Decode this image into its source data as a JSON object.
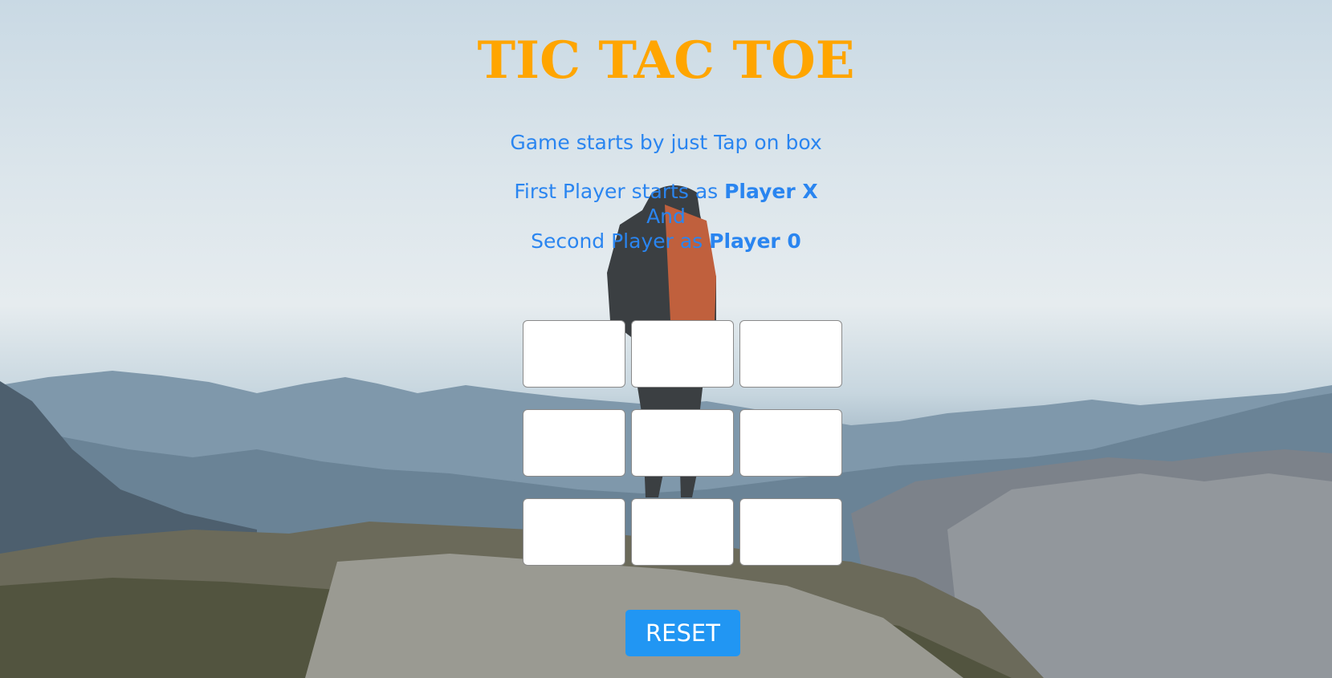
{
  "title": "TIC TAC TOE",
  "instructions": {
    "line1": "Game starts by just Tap on box",
    "line2_prefix": "First Player starts as ",
    "line2_bold": "Player X",
    "line3": "And",
    "line4_prefix": "Second Player as ",
    "line4_bold": "Player 0"
  },
  "board": {
    "cells": [
      "",
      "",
      "",
      "",
      "",
      "",
      "",
      "",
      ""
    ]
  },
  "reset_label": "RESET",
  "colors": {
    "title": "#ffa500",
    "instructions": "#2a85f0",
    "reset_button": "#2196f3",
    "cell_background": "#ffffff"
  },
  "background": {
    "icon": "mountain-hiker-photo"
  }
}
